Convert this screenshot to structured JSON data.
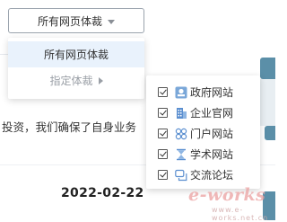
{
  "dropdown": {
    "selected_label": "所有网页体裁",
    "options": [
      {
        "label": "所有网页体裁",
        "active": true
      },
      {
        "label": "指定体裁",
        "has_submenu": true
      }
    ]
  },
  "submenu": {
    "items": [
      {
        "label": "政府网站",
        "checked": true,
        "icon": "government-icon"
      },
      {
        "label": "企业官网",
        "checked": true,
        "icon": "building-icon"
      },
      {
        "label": "门户网站",
        "checked": true,
        "icon": "portal-icon"
      },
      {
        "label": "学术网站",
        "checked": true,
        "icon": "hourglass-icon"
      },
      {
        "label": "交流论坛",
        "checked": true,
        "icon": "chat-icon"
      }
    ]
  },
  "background": {
    "snippet_text": "投资，我们确保了自身业务",
    "date": "2022-02-22"
  },
  "watermark": {
    "brand": "e-works",
    "sub": "www.e-works.net.cn"
  },
  "colors": {
    "accent": "#4a90d9",
    "active_bg": "#e9f2fc",
    "muted_text": "#9a9fa6",
    "strip": "#5b8fa8"
  }
}
